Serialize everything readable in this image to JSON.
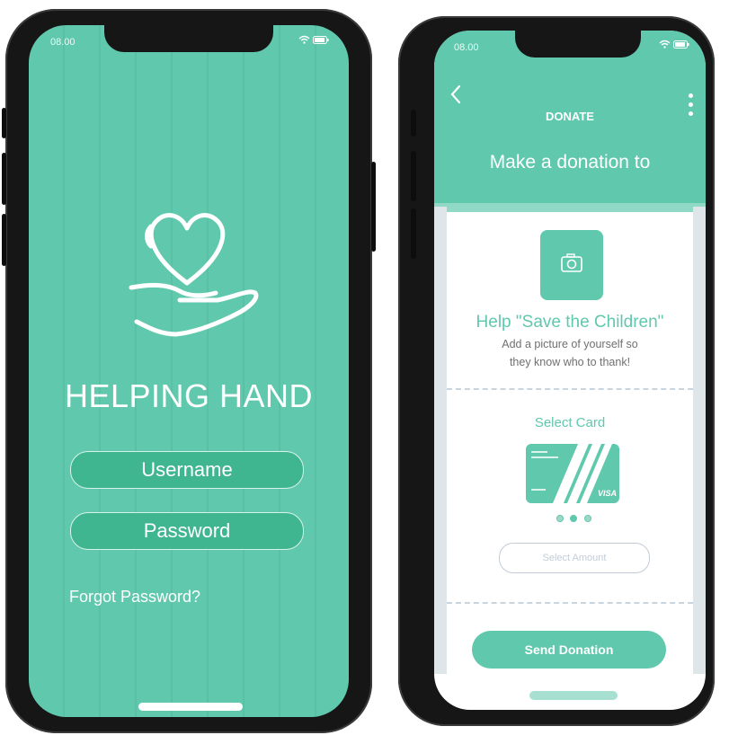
{
  "login_screen": {
    "status_time": "08.00",
    "app_title": "HELPING HAND",
    "username_placeholder": "Username",
    "password_placeholder": "Password",
    "forgot_link": "Forgot Password?"
  },
  "donate_screen": {
    "status_time": "08.00",
    "header_title": "DONATE",
    "heading": "Make a donation to",
    "help_title": "Help \"Save the Children\"",
    "help_sub_line1": "Add a picture of yourself so",
    "help_sub_line2": "they know who to thank!",
    "select_card_label": "Select Card",
    "card_brand": "VISA",
    "select_amount": "Select Amount",
    "send_button": "Send Donation",
    "card_page_count": 3,
    "card_selected_index": 1
  },
  "icons": [
    "wifi-icon",
    "battery-icon",
    "back-arrow-icon",
    "more-vert-icon",
    "camera-icon",
    "heart-hand-icon"
  ],
  "colors": {
    "accent": "#5fc8ad",
    "accent_dark": "#3fb68f",
    "white": "#ffffff"
  }
}
